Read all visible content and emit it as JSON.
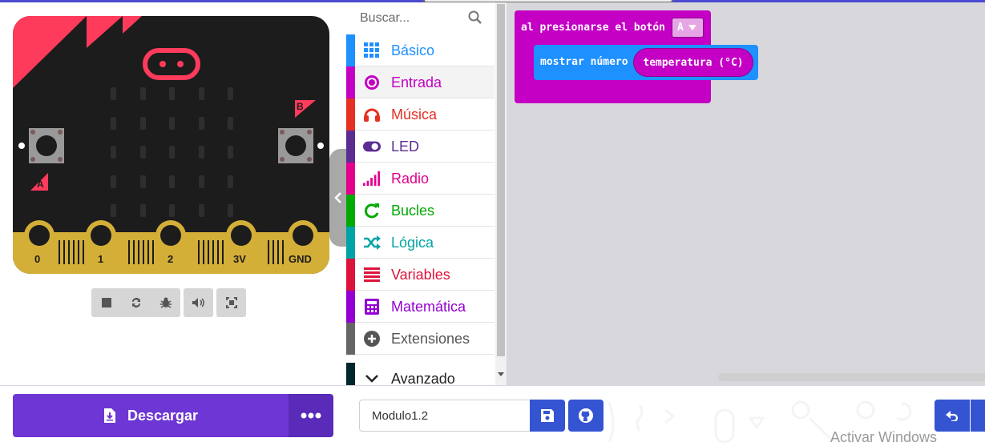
{
  "toolbox": {
    "search_placeholder": "Buscar...",
    "categories": [
      {
        "label": "Básico",
        "color": "#1e90ff",
        "icon": "grid-icon"
      },
      {
        "label": "Entrada",
        "color": "#c400c4",
        "icon": "target-icon"
      },
      {
        "label": "Música",
        "color": "#e63022",
        "icon": "headphones-icon"
      },
      {
        "label": "LED",
        "color": "#5c2d91",
        "icon": "toggle-icon"
      },
      {
        "label": "Radio",
        "color": "#e3008c",
        "icon": "signal-bars-icon"
      },
      {
        "label": "Bucles",
        "color": "#00aa00",
        "icon": "loop-arrow-icon"
      },
      {
        "label": "Lógica",
        "color": "#00a4a6",
        "icon": "shuffle-icon"
      },
      {
        "label": "Variables",
        "color": "#dc143c",
        "icon": "list-lines-icon"
      },
      {
        "label": "Matemática",
        "color": "#9400d3",
        "icon": "calculator-icon"
      },
      {
        "label": "Extensiones",
        "color": "#666666",
        "icon": "plus-circle-icon"
      },
      {
        "label": "Avanzado",
        "color": "#00272b",
        "icon": "chevron-down-icon"
      }
    ]
  },
  "board": {
    "button_a": "A",
    "button_b": "B",
    "pins": [
      "0",
      "1",
      "2",
      "3V",
      "GND"
    ],
    "accent": "#ff3b5c"
  },
  "workspace": {
    "event_label": "al presionarse el botón",
    "event_dropdown_value": "A",
    "statement_label": "mostrar número",
    "reporter_label": "temperatura (°C)"
  },
  "bottom": {
    "download_label": "Descargar",
    "project_name": "Modulo1.2",
    "watermark": "Activar Windows"
  },
  "colors": {
    "download": "#6e36d4",
    "action_blue": "#3454d1",
    "event_block": "#c400c4",
    "statement_block": "#1e90ff"
  }
}
